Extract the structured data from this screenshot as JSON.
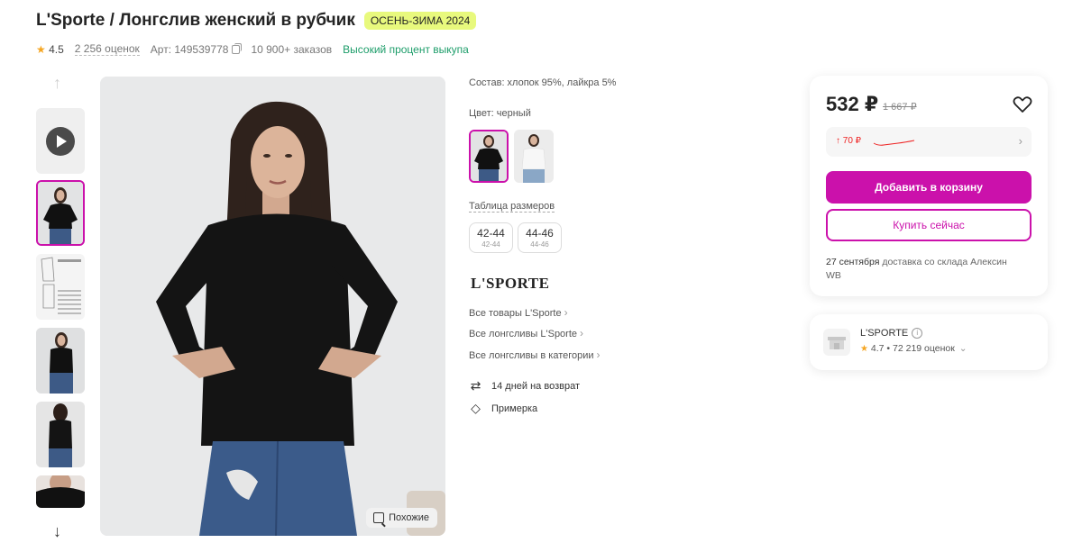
{
  "product": {
    "title": "L'Sporte / Лонгслив женский в рубчик",
    "season_badge": "ОСЕНЬ-ЗИМА 2024",
    "rating": "4.5",
    "reviews": "2 256 оценок",
    "article": "Арт: 149539778",
    "orders": "10 900+ заказов",
    "buyout": "Высокий процент выкупа"
  },
  "gallery": {
    "similar_label": "Похожие"
  },
  "details": {
    "composition": "Состав: хлопок 95%, лайкра 5%",
    "color_label": "Цвет: черный",
    "size_table_label": "Таблица размеров",
    "sizes": [
      {
        "label": "42-44",
        "sub": "42-44"
      },
      {
        "label": "44-46",
        "sub": "44-46"
      }
    ],
    "brand_logo": "L'SPORTE",
    "links": [
      "Все товары L'Sporte",
      "Все лонгсливы L'Sporte",
      "Все лонгсливы в категории"
    ],
    "features": [
      "14 дней на возврат",
      "Примерка"
    ]
  },
  "purchase": {
    "price": "532 ₽",
    "old_price": "1 667 ₽",
    "history_value": "↑ 70 ₽",
    "add_to_cart": "Добавить в корзину",
    "buy_now": "Купить сейчас",
    "delivery_date": "27 сентября",
    "delivery_text": "доставка со склада Алексин WB"
  },
  "seller": {
    "name": "L'SPORTE",
    "rating": "4.7",
    "reviews": "72 219 оценок"
  },
  "colors": {
    "accent": "#cb11ab",
    "badge": "#e8f97d",
    "buyout_green": "#1d9d6a",
    "price_up": "#ee2222"
  }
}
